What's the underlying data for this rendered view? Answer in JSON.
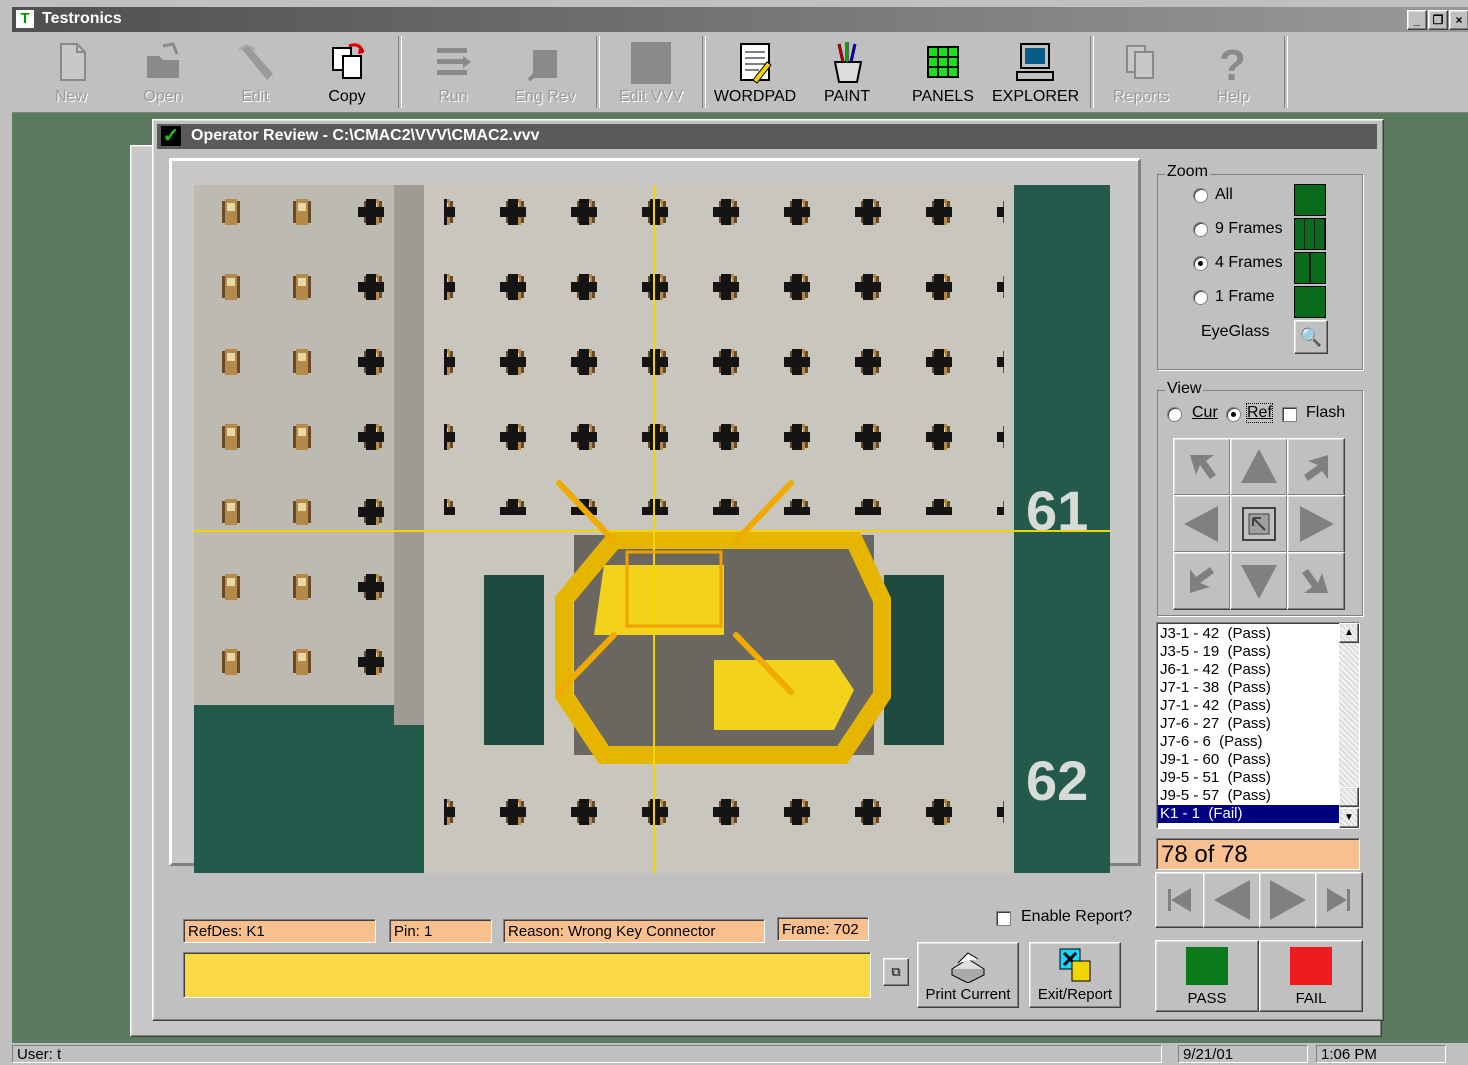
{
  "app": {
    "title": "Testronics",
    "icon_letter": "T"
  },
  "window_controls": {
    "minimize": "_",
    "restore": "❐",
    "close": "×"
  },
  "toolbar": {
    "buttons": [
      {
        "label": "New",
        "icon": "new-document-icon",
        "enabled": false
      },
      {
        "label": "Open",
        "icon": "folder-open-icon",
        "enabled": false
      },
      {
        "label": "Edit",
        "icon": "pencil-icon",
        "enabled": false
      },
      {
        "label": "Copy",
        "icon": "copy-icon",
        "enabled": true
      },
      {
        "label": "Run",
        "icon": "run-icon",
        "enabled": false
      },
      {
        "label": "Eng Rev",
        "icon": "eng-rev-icon",
        "enabled": false
      },
      {
        "label": "Edit VVV",
        "icon": "edit-vvv-icon",
        "enabled": false
      },
      {
        "label": "WORDPAD",
        "icon": "wordpad-icon",
        "enabled": true
      },
      {
        "label": "PAINT",
        "icon": "paint-icon",
        "enabled": true
      },
      {
        "label": "PANELS",
        "icon": "panels-grid-icon",
        "enabled": true
      },
      {
        "label": "EXPLORER",
        "icon": "explorer-computer-icon",
        "enabled": true
      },
      {
        "label": "Reports",
        "icon": "reports-icon",
        "enabled": false
      },
      {
        "label": "Help",
        "icon": "help-question-icon",
        "enabled": false
      }
    ]
  },
  "dialog": {
    "title": "Operator Review - C:\\CMAC2\\VVV\\CMAC2.vvv",
    "board_labels": {
      "row61": "61",
      "row62": "62"
    }
  },
  "zoom": {
    "label": "Zoom",
    "options": [
      {
        "text": "All",
        "accel": "A",
        "checked": false
      },
      {
        "text": "9 Frames",
        "accel": "9",
        "checked": false
      },
      {
        "text": "4 Frames",
        "accel": "4",
        "checked": true
      },
      {
        "text": "1 Frame",
        "accel": "1",
        "checked": false
      }
    ],
    "eyeglass": "EyeGlass"
  },
  "view": {
    "label": "View",
    "cur": "Cur",
    "ref": "Ref",
    "flash": "Flash",
    "selected": "Ref",
    "flash_checked": false
  },
  "results": {
    "items": [
      "J3-1 - 42  (Pass)",
      "J3-5 - 19  (Pass)",
      "J6-1 - 42  (Pass)",
      "J7-1 - 38  (Pass)",
      "J7-1 - 42  (Pass)",
      "J7-6 - 27  (Pass)",
      "J7-6 - 6  (Pass)",
      "J9-1 - 60  (Pass)",
      "J9-5 - 51  (Pass)",
      "J9-5 - 57  (Pass)",
      "K1 - 1  (Fail)"
    ],
    "selected_index": 10,
    "counter": "78 of 78"
  },
  "details": {
    "refdes": "RefDes: K1",
    "pin": "Pin: 1",
    "reason": "Reason: Wrong Key Connector",
    "frame": "Frame: 702",
    "comment_value": ""
  },
  "enable_report": {
    "label": "Enable Report?",
    "checked": false
  },
  "actions": {
    "print_current": "Print Current",
    "exit_report": "Exit/Report",
    "pass": "PASS",
    "fail": "FAIL"
  },
  "statusbar": {
    "user": "User: t",
    "date": "9/21/01",
    "time": "1:06 PM"
  },
  "colors": {
    "info_fill": "#f9c08f",
    "comment_fill": "#fbd844",
    "pass_green": "#0a7a1a",
    "fail_red": "#ee1c1c",
    "crosshair_yellow": "#f1d400",
    "selection_navy": "#000080"
  }
}
